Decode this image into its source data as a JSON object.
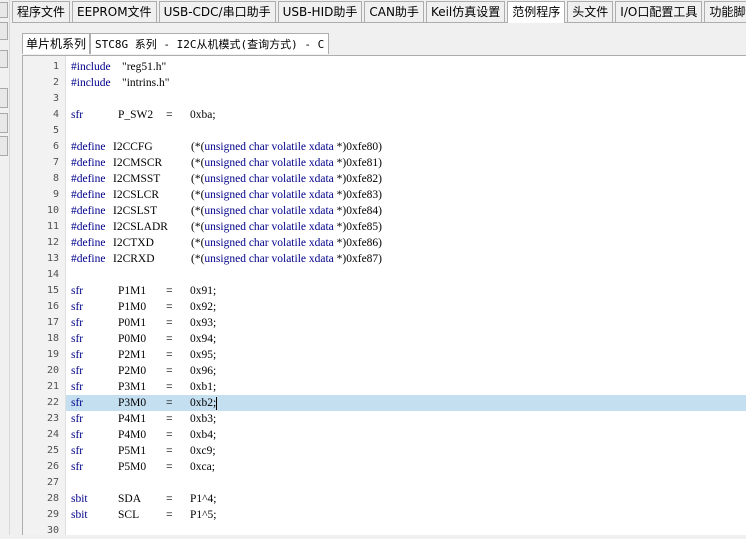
{
  "top_tabs": [
    {
      "label": "程序文件",
      "active": false
    },
    {
      "label": "EEPROM文件",
      "active": false
    },
    {
      "label": "USB-CDC/串口助手",
      "active": false
    },
    {
      "label": "USB-HID助手",
      "active": false
    },
    {
      "label": "CAN助手",
      "active": false
    },
    {
      "label": "Keil仿真设置",
      "active": false
    },
    {
      "label": "范例程序",
      "active": true
    },
    {
      "label": "头文件",
      "active": false
    },
    {
      "label": "I/O口配置工具",
      "active": false
    },
    {
      "label": "功能脚切换",
      "active": false
    }
  ],
  "sub_tabs": {
    "category": "单片机系列",
    "file": "STC8G 系列 - I2C从机模式(查询方式) - C"
  },
  "editor": {
    "current_line": 22,
    "lines": [
      {
        "n": "1",
        "type": "pp",
        "a": "#include",
        "b": "\"reg51.h\""
      },
      {
        "n": "2",
        "type": "pp",
        "a": "#include",
        "b": "\"intrins.h\""
      },
      {
        "n": "3",
        "type": "blank"
      },
      {
        "n": "4",
        "type": "sfr",
        "kw": "sfr",
        "name": "P_SW2",
        "eq": "=",
        "val": "0xba;"
      },
      {
        "n": "5",
        "type": "blank"
      },
      {
        "n": "6",
        "type": "def",
        "name": "I2CCFG",
        "val": "(*(unsigned char volatile xdata *)0xfe80)"
      },
      {
        "n": "7",
        "type": "def",
        "name": "I2CMSCR",
        "val": "(*(unsigned char volatile xdata *)0xfe81)"
      },
      {
        "n": "8",
        "type": "def",
        "name": "I2CMSST",
        "val": "(*(unsigned char volatile xdata *)0xfe82)"
      },
      {
        "n": "9",
        "type": "def",
        "name": "I2CSLCR",
        "val": "(*(unsigned char volatile xdata *)0xfe83)"
      },
      {
        "n": "10",
        "type": "def",
        "name": "I2CSLST",
        "val": "(*(unsigned char volatile xdata *)0xfe84)"
      },
      {
        "n": "11",
        "type": "def",
        "name": "I2CSLADR",
        "val": "(*(unsigned char volatile xdata *)0xfe85)"
      },
      {
        "n": "12",
        "type": "def",
        "name": "I2CTXD",
        "val": "(*(unsigned char volatile xdata *)0xfe86)"
      },
      {
        "n": "13",
        "type": "def",
        "name": "I2CRXD",
        "val": "(*(unsigned char volatile xdata *)0xfe87)"
      },
      {
        "n": "14",
        "type": "blank"
      },
      {
        "n": "15",
        "type": "sfr",
        "kw": "sfr",
        "name": "P1M1",
        "eq": "=",
        "val": "0x91;"
      },
      {
        "n": "16",
        "type": "sfr",
        "kw": "sfr",
        "name": "P1M0",
        "eq": "=",
        "val": "0x92;"
      },
      {
        "n": "17",
        "type": "sfr",
        "kw": "sfr",
        "name": "P0M1",
        "eq": "=",
        "val": "0x93;"
      },
      {
        "n": "18",
        "type": "sfr",
        "kw": "sfr",
        "name": "P0M0",
        "eq": "=",
        "val": "0x94;"
      },
      {
        "n": "19",
        "type": "sfr",
        "kw": "sfr",
        "name": "P2M1",
        "eq": "=",
        "val": "0x95;"
      },
      {
        "n": "20",
        "type": "sfr",
        "kw": "sfr",
        "name": "P2M0",
        "eq": "=",
        "val": "0x96;"
      },
      {
        "n": "21",
        "type": "sfr",
        "kw": "sfr",
        "name": "P3M1",
        "eq": "=",
        "val": "0xb1;"
      },
      {
        "n": "22",
        "type": "sfr",
        "kw": "sfr",
        "name": "P3M0",
        "eq": "=",
        "val": "0xb2;"
      },
      {
        "n": "23",
        "type": "sfr",
        "kw": "sfr",
        "name": "P4M1",
        "eq": "=",
        "val": "0xb3;"
      },
      {
        "n": "24",
        "type": "sfr",
        "kw": "sfr",
        "name": "P4M0",
        "eq": "=",
        "val": "0xb4;"
      },
      {
        "n": "25",
        "type": "sfr",
        "kw": "sfr",
        "name": "P5M1",
        "eq": "=",
        "val": "0xc9;"
      },
      {
        "n": "26",
        "type": "sfr",
        "kw": "sfr",
        "name": "P5M0",
        "eq": "=",
        "val": "0xca;"
      },
      {
        "n": "27",
        "type": "blank"
      },
      {
        "n": "28",
        "type": "sfr",
        "kw": "sbit",
        "name": "SDA",
        "eq": "=",
        "val": "P1^4;"
      },
      {
        "n": "29",
        "type": "sfr",
        "kw": "sbit",
        "name": "SCL",
        "eq": "=",
        "val": "P1^5;"
      },
      {
        "n": "30",
        "type": "blank"
      }
    ]
  },
  "colors": {
    "highlight": "#c4dff0",
    "keyword": "#00008b"
  }
}
